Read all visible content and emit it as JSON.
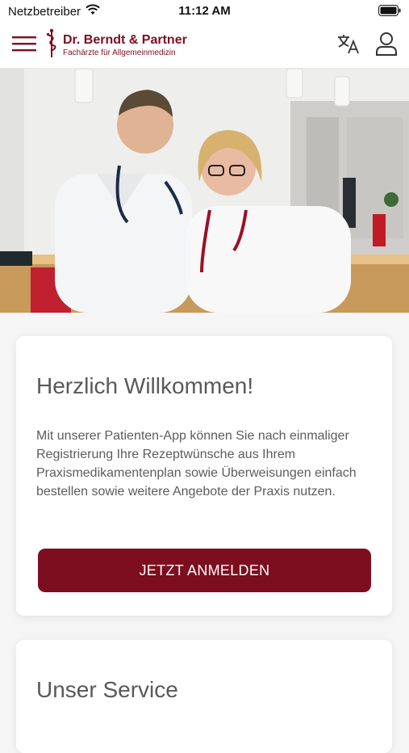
{
  "status_bar": {
    "carrier": "Netzbetreiber",
    "time": "11:12 AM"
  },
  "header": {
    "logo_title": "Dr. Berndt & Partner",
    "logo_subtitle": "Fachärzte für Allgemeinmedizin",
    "menu_icon": "hamburger-menu-icon",
    "language_icon": "translate-icon",
    "account_icon": "user-icon"
  },
  "welcome": {
    "title": "Herzlich Willkommen!",
    "text": "Mit unserer Patienten-App können Sie nach einmaliger Registrierung Ihre Rezeptwünsche aus Ihrem Praxismedikamentenplan sowie Überweisungen einfach bestellen sowie weitere Angebote der Praxis nutzen.",
    "button_label": "JETZT ANMELDEN"
  },
  "service": {
    "title": "Unser Service"
  },
  "colors": {
    "brand": "#7d0e1f",
    "background": "#f5f5f5",
    "card": "#ffffff"
  }
}
